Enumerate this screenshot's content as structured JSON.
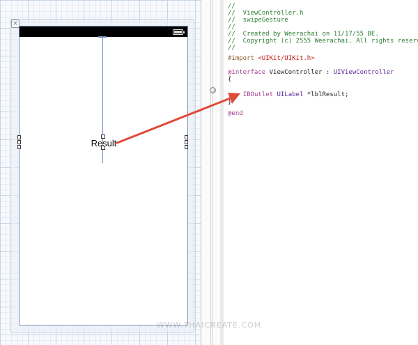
{
  "storyboard": {
    "label_text": "Result"
  },
  "editor": {
    "lines": [
      [
        {
          "text": "//",
          "kind": "comment"
        }
      ],
      [
        {
          "text": "//  ViewController.h",
          "kind": "comment"
        }
      ],
      [
        {
          "text": "//  swipeGesture",
          "kind": "comment"
        }
      ],
      [
        {
          "text": "//",
          "kind": "comment"
        }
      ],
      [
        {
          "text": "//  Created by Weerachai on 11/17/55 BE.",
          "kind": "comment"
        }
      ],
      [
        {
          "text": "//  Copyright (c) 2555 Weerachai. All rights reserved.",
          "kind": "comment"
        }
      ],
      [
        {
          "text": "//",
          "kind": "comment"
        }
      ],
      [],
      [
        {
          "text": "#import ",
          "kind": "directive"
        },
        {
          "text": "<UIKit/UIKit.h>",
          "kind": "string"
        }
      ],
      [],
      [
        {
          "text": "@interface",
          "kind": "keyword"
        },
        {
          "text": " ViewController : ",
          "kind": "plain"
        },
        {
          "text": "UIViewController",
          "kind": "type"
        }
      ],
      [
        {
          "text": "{",
          "kind": "plain"
        }
      ],
      [],
      [
        {
          "text": "    ",
          "kind": "plain"
        },
        {
          "text": "IBOutlet",
          "kind": "keyword"
        },
        {
          "text": " ",
          "kind": "plain"
        },
        {
          "text": "UILabel",
          "kind": "type"
        },
        {
          "text": " *lblResult;",
          "kind": "plain"
        }
      ],
      [
        {
          "text": "}",
          "kind": "plain"
        }
      ],
      [],
      [
        {
          "text": "@end",
          "kind": "keyword"
        }
      ]
    ]
  },
  "watermark": "WWW.THAICREATE.COM",
  "colors": {
    "arrow": "#e04a3a",
    "comment": "#2e7d32",
    "keyword": "#a33a8f",
    "type": "#5c2699",
    "string": "#c41a16"
  }
}
